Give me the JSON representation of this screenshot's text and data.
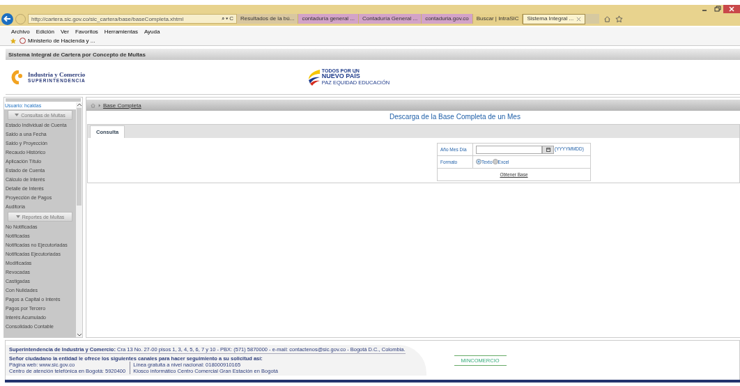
{
  "browser": {
    "url": "http://cartera.sic.gov.co/sic_cartera/base/baseCompleta.xhtml",
    "search_caret": "⌕ ▾ C",
    "tabs": [
      {
        "label": "Resultados de la bú...",
        "selected": false,
        "color": "#d9c7a0"
      },
      {
        "label": "contaduría general ...",
        "selected": false,
        "color": "#d3a3c8"
      },
      {
        "label": "Contaduría General ...",
        "selected": false,
        "color": "#d3a3c8"
      },
      {
        "label": "contaduria.gov.co",
        "selected": false,
        "color": "#d3a3c8"
      },
      {
        "label": "Buscar | IntraSIC",
        "selected": false,
        "color": "#e6d08a"
      },
      {
        "label": "Sistema Integral ...",
        "selected": true,
        "color": "#fbf3cf"
      }
    ],
    "menu": [
      "Archivo",
      "Edición",
      "Ver",
      "Favoritos",
      "Herramientas",
      "Ayuda"
    ],
    "favorites": [
      "Ministerio de Hacienda y ..."
    ]
  },
  "app": {
    "title": "Sistema Integral de Cartera por Concepto de Multas",
    "logo_left": {
      "name": "Industria y Comercio",
      "sub": "SUPERINTENDENCIA"
    },
    "logo_center": {
      "line1": "TODOS POR UN",
      "line2": "NUEVO PAÍS",
      "line3": "PAZ   EQUIDAD   EDUCACIÓN"
    }
  },
  "sidebar": {
    "user": "Usuario: hcaldas",
    "groups": [
      {
        "title": "Consultas de Multas",
        "expanded": true,
        "items": [
          "Estado Individual de Cuenta",
          "Saldo a una Fecha",
          "Saldo y Proyección",
          "Recaudo Histórico",
          "Aplicación Título",
          "Estado de Cuenta",
          "Cálculo de Interés",
          "Detalle de Interés",
          "Proyección de Pagos",
          "Auditoría"
        ]
      },
      {
        "title": "Reportes de Multas",
        "expanded": true,
        "items": [
          "No Notificadas",
          "Notificadas",
          "Notificadas no Ejecutoriadas",
          "Notificadas Ejecutoriadas",
          "Modificadas",
          "Revocadas",
          "Castigadas",
          "Con Nulidades",
          "Pagos a Capital o Interés",
          "Pagos por Tercero",
          "Interés Acumulado",
          "Consolidado Contable"
        ]
      }
    ]
  },
  "breadcrumb": "Base Completa",
  "page_title": "Descarga de la Base Completa de un Mes",
  "tabs": [
    {
      "label": "Consulta",
      "selected": true
    }
  ],
  "form": {
    "date_label": "Año Mes Día",
    "date_hint": "(YYYYMMDD)",
    "format_label": "Formato",
    "formats": [
      {
        "label": "Texto",
        "selected": true
      },
      {
        "label": "Excel",
        "selected": false
      }
    ],
    "submit": "Obtener Base"
  },
  "footer": {
    "address": "**Superintendencia de Industria y Comercio:** Cra 13 No. 27-00 pisos 1, 3, 4, 5, 6, 7 y 10 - PBX: (571) 5870000 - e-mail: contactenos@sic.gov.co - Bogotá D.C., Colombia.",
    "channels_title": "Señor ciudadano la entidad le ofrece los siguientes canales para hacer seguimiento a su solicitud así:",
    "col1": [
      "Página web: www.sic.gov.co",
      "Centro de atención telefónica en Bogotá: 5920400"
    ],
    "col2": [
      "Línea gratuita a nivel nacional: 018000910165",
      "Kiosco informático Centro Comercial Gran Estación en Bogotá"
    ],
    "ministry": "MINCOMERCIO"
  }
}
